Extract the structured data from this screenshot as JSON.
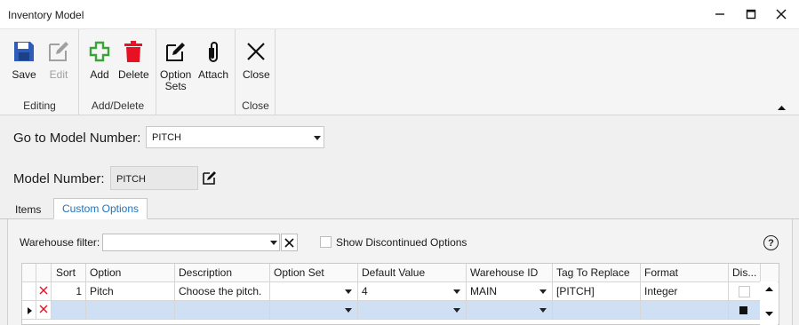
{
  "window": {
    "title": "Inventory Model"
  },
  "ribbon": {
    "editing": {
      "label": "Editing",
      "save": "Save",
      "edit": "Edit"
    },
    "add_delete": {
      "label": "Add/Delete",
      "add": "Add",
      "delete": "Delete"
    },
    "option_sets": "Option\nSets",
    "attach": "Attach",
    "close_group": {
      "label": "Close",
      "close": "Close"
    }
  },
  "goto": {
    "label": "Go to Model Number:",
    "value": "PITCH"
  },
  "model": {
    "label": "Model Number:",
    "value": "PITCH"
  },
  "tabs": [
    "Items",
    "Custom Options"
  ],
  "filter": {
    "label": "Warehouse filter:",
    "value": "",
    "show_discontinued": "Show Discontinued Options",
    "help": "?"
  },
  "grid": {
    "columns": [
      "Sort",
      "Option",
      "Description",
      "Option Set",
      "Default Value",
      "Warehouse ID",
      "Tag To Replace",
      "Format",
      "Dis..."
    ],
    "rows": [
      {
        "sort": "1",
        "option": "Pitch",
        "description": "Choose the pitch.",
        "option_set": "",
        "default_value": "4",
        "warehouse_id": "MAIN",
        "tag": "[PITCH]",
        "format": "Integer"
      }
    ]
  },
  "colors": {
    "save": "#2e5cb8",
    "add": "#3aa33a",
    "delete": "#e81123",
    "delete_x": "#e81123",
    "tab_active": "#1e73be",
    "new_row": "#cfe0f5"
  }
}
